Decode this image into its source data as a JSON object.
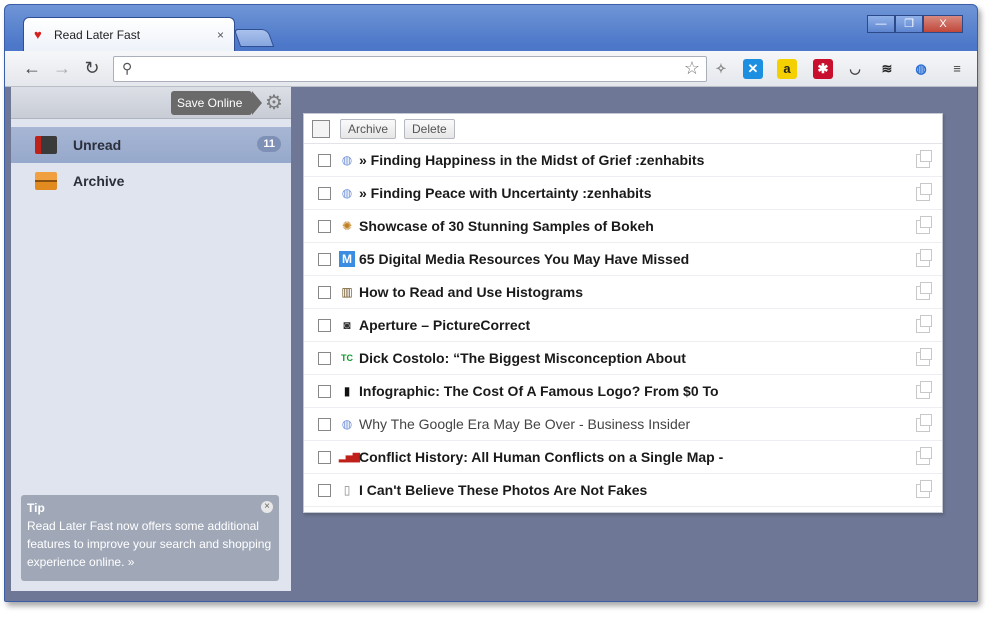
{
  "browser": {
    "tab_title": "Read Later Fast",
    "tab_close": "×",
    "window_buttons": [
      "—",
      "❐",
      "X"
    ],
    "nav": {
      "back": "←",
      "forward": "→",
      "reload": "↻"
    },
    "omnibox": {
      "value": "",
      "search_glyph": "⚲",
      "star_glyph": "☆"
    },
    "extensions": [
      {
        "name": "puzzle-icon",
        "glyph": "✧",
        "color": "#888888",
        "bg": "transparent"
      },
      {
        "name": "x-ext-icon",
        "glyph": "✕",
        "color": "#ffffff",
        "bg": "#1d8fe0"
      },
      {
        "name": "amazon-icon",
        "glyph": "a",
        "color": "#222222",
        "bg": "#f5d000"
      },
      {
        "name": "asterisk-ext-icon",
        "glyph": "✱",
        "color": "#ffffff",
        "bg": "#c8102e"
      },
      {
        "name": "pocket-icon",
        "glyph": "◡",
        "color": "#444444",
        "bg": "transparent"
      },
      {
        "name": "layers-icon",
        "glyph": "≋",
        "color": "#222222",
        "bg": "transparent"
      },
      {
        "name": "globe-ext-icon",
        "glyph": "◍",
        "color": "#2a6fd6",
        "bg": "transparent"
      },
      {
        "name": "menu-icon",
        "glyph": "≡",
        "color": "#444444",
        "bg": "transparent"
      }
    ]
  },
  "app": {
    "save_online": "Save Online",
    "gear_glyph": "⚙",
    "sidebar": {
      "items": [
        {
          "label": "Unread",
          "count": "11",
          "active": true
        },
        {
          "label": "Archive",
          "count": "",
          "active": false
        }
      ]
    },
    "tip": {
      "heading": "Tip",
      "text": "Read Later Fast now offers some additional features to improve your search and shopping experience online. »",
      "close": "×"
    },
    "actions": {
      "archive": "Archive",
      "delete": "Delete"
    },
    "items": [
      {
        "favicon": "globe",
        "title": "» Finding Happiness in the Midst of Grief :zenhabits",
        "bold": true
      },
      {
        "favicon": "globe",
        "title": "» Finding Peace with Uncertainty :zenhabits",
        "bold": true
      },
      {
        "favicon": "bokeh",
        "title": "Showcase of 30 Stunning Samples of Bokeh",
        "bold": true
      },
      {
        "favicon": "M",
        "title": "65 Digital Media Resources You May Have Missed",
        "bold": true
      },
      {
        "favicon": "histo",
        "title": "How to Read and Use Histograms",
        "bold": true
      },
      {
        "favicon": "camera",
        "title": "Aperture – PictureCorrect",
        "bold": true
      },
      {
        "favicon": "TC",
        "title": "Dick Costolo: “The Biggest Misconception About",
        "bold": true
      },
      {
        "favicon": "doc-black",
        "title": "Infographic: The Cost Of A Famous Logo? From $0 To",
        "bold": true
      },
      {
        "favicon": "globe",
        "title": "Why The Google Era May Be Over - Business Insider",
        "bold": false
      },
      {
        "favicon": "bars",
        "title": "Conflict History: All Human Conflicts on a Single Map -",
        "bold": true
      },
      {
        "favicon": "page",
        "title": "I Can't Believe These Photos Are Not Fakes",
        "bold": true
      }
    ]
  }
}
